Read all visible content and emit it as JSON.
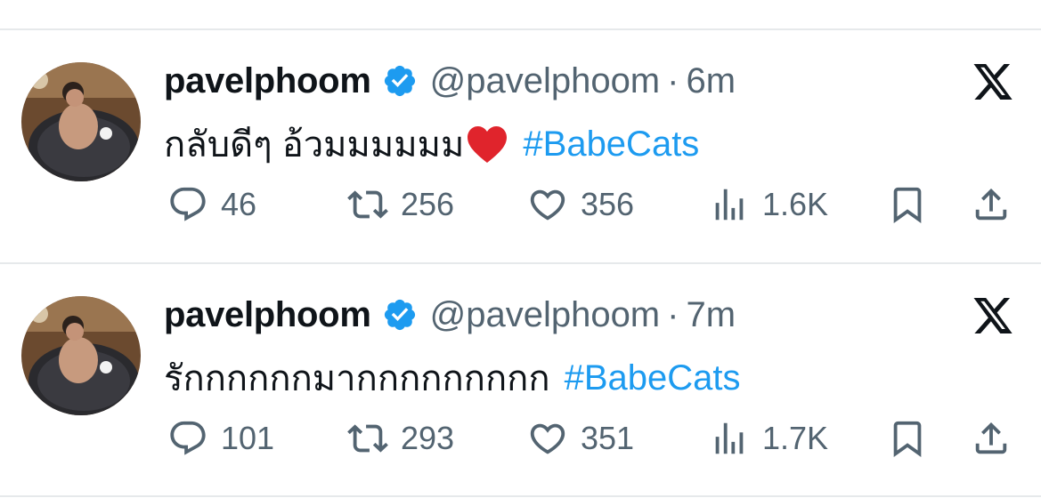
{
  "icons": {
    "verified": "verified-badge-icon",
    "brand": "x-logo-icon",
    "reply": "reply-icon",
    "repost": "repost-icon",
    "like": "like-icon",
    "views": "views-icon",
    "bookmark": "bookmark-icon",
    "share": "share-icon",
    "emoji": "red-heart-emoji-icon"
  },
  "colors": {
    "text": "#0f1419",
    "secondary": "#536471",
    "link": "#1d9bf0",
    "verified": "#1d9bf0",
    "divider": "#e6e9eb"
  },
  "tweets": [
    {
      "display_name": "pavelphoom",
      "handle": "@pavelphoom",
      "separator": "·",
      "time": "6m",
      "text": "กลับดีๆ อ้วมมมมมม",
      "hashtag": "#BabeCats",
      "replies": "46",
      "reposts": "256",
      "likes": "356",
      "views": "1.6K"
    },
    {
      "display_name": "pavelphoom",
      "handle": "@pavelphoom",
      "separator": "·",
      "time": "7m",
      "text": "รักกกกกกมากกกกกกกกก",
      "hashtag": "#BabeCats",
      "replies": "101",
      "reposts": "293",
      "likes": "351",
      "views": "1.7K"
    }
  ]
}
